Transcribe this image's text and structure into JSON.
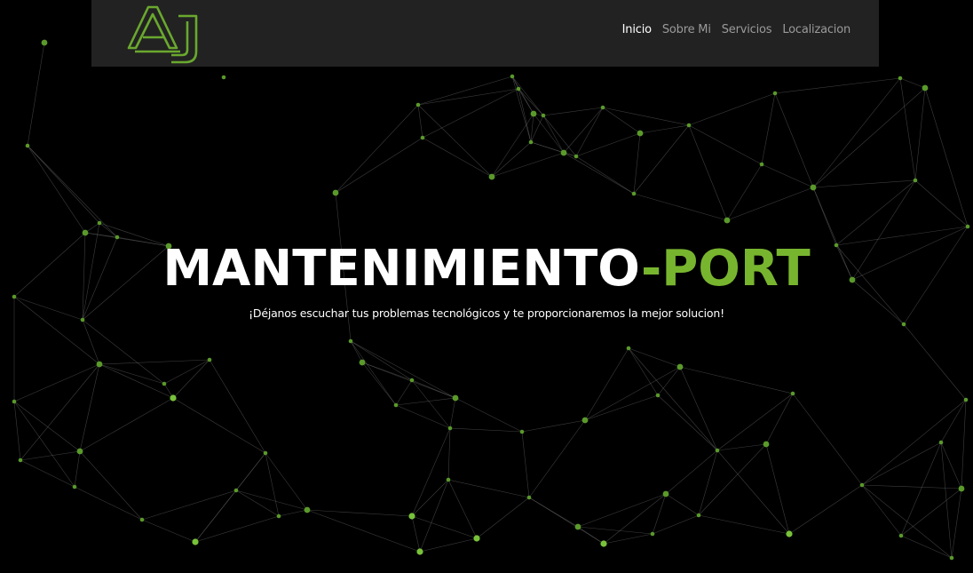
{
  "nav": {
    "logo_text": "AJ",
    "links": [
      {
        "label": "Inicio",
        "active": true
      },
      {
        "label": "Sobre Mi",
        "active": false
      },
      {
        "label": "Servicios",
        "active": false
      },
      {
        "label": "Localizacion",
        "active": false
      }
    ]
  },
  "hero": {
    "title_main": "MANTENIMIENTO",
    "title_accent": "-PORT",
    "subtitle": "¡Déjanos escuchar tus problemas tecnológicos y te proporcionaremos la mejor solucion!"
  },
  "colors": {
    "background": "#000000",
    "navbar": "#222222",
    "accent": "#78b52f",
    "nav_active": "#ffffff",
    "nav_inactive": "#9a9a9a"
  }
}
